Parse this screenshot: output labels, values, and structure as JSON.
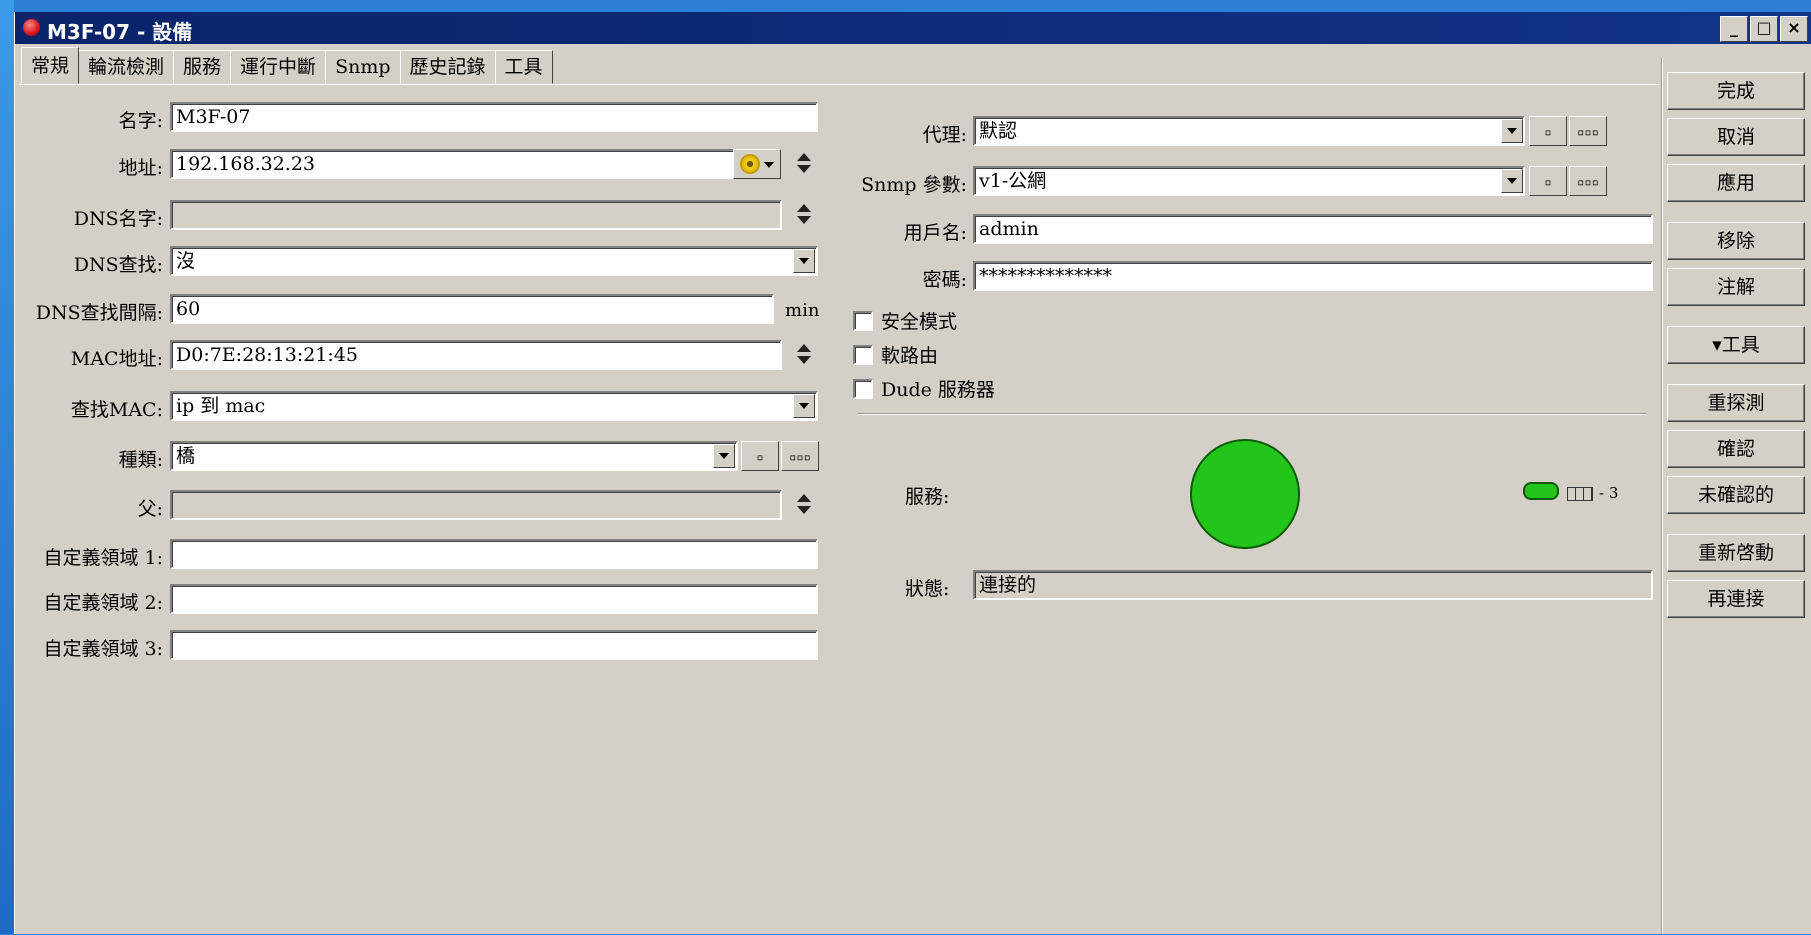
{
  "window": {
    "title": "M3F-07 - 設備"
  },
  "tabs": [
    "常規",
    "輪流檢測",
    "服務",
    "運行中斷",
    "Snmp",
    "歷史記錄",
    "工具"
  ],
  "left": {
    "name_label": "名字:",
    "name_value": "M3F-07",
    "address_label": "地址:",
    "address_value": "192.168.32.23",
    "dns_name_label": "DNS名字:",
    "dns_name_value": "",
    "dns_lookup_label": "DNS查找:",
    "dns_lookup_value": "沒",
    "dns_interval_label": "DNS查找間隔:",
    "dns_interval_value": "60",
    "dns_interval_unit": "min",
    "mac_label": "MAC地址:",
    "mac_value": "D0:7E:28:13:21:45",
    "lookup_mac_label": "查找MAC:",
    "lookup_mac_value": "ip 到 mac",
    "type_label": "種類:",
    "type_value": "橋",
    "parent_label": "父:",
    "parent_value": "",
    "custom1_label": "自定義領域 1:",
    "custom1_value": "",
    "custom2_label": "自定義領域 2:",
    "custom2_value": "",
    "custom3_label": "自定義領域 3:",
    "custom3_value": ""
  },
  "right": {
    "agent_label": "代理:",
    "agent_value": "默認",
    "snmp_label": "Snmp 參數:",
    "snmp_value": "v1-公網",
    "user_label": "用戶名:",
    "user_value": "admin",
    "password_label": "密碼:",
    "password_value": "**************",
    "secure_mode": "安全模式",
    "router_os": "軟路由",
    "dude_server": "Dude 服務器",
    "services_label": "服務:",
    "services_mini": "- 3",
    "status_label": "狀態:",
    "status_value": "連接的"
  },
  "small_buttons": {
    "single": "▫",
    "more": "▫▫▫"
  },
  "side_buttons": {
    "ok": "完成",
    "cancel": "取消",
    "apply": "應用",
    "remove": "移除",
    "comment": "注解",
    "tools": "▾工具",
    "reprobe": "重探測",
    "ack": "確認",
    "unack": "未確認的",
    "reboot": "重新啓動",
    "reconnect": "再連接"
  },
  "colors": {
    "service_up": "#22c51a",
    "titlebar": "#0a246a"
  }
}
